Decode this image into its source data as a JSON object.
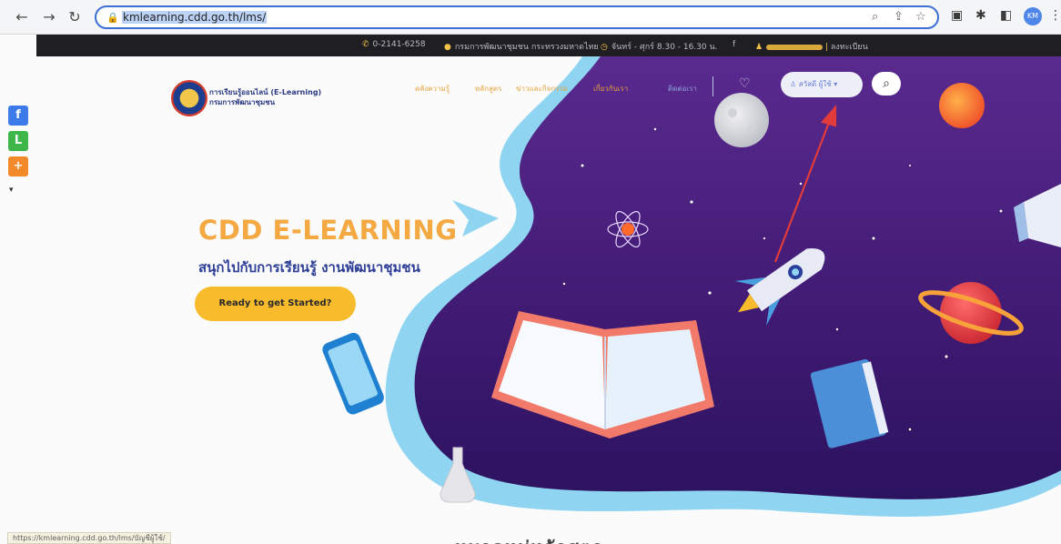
{
  "browser": {
    "url": "kmlearning.cdd.go.th/lms/",
    "profile_initials": "KM",
    "status_url": "https://kmlearning.cdd.go.th/lms/บัญชีผู้ใช้/"
  },
  "topbar": {
    "phone": "0-2141-6258",
    "address": "กรมการพัฒนาชุมชน กระทรวงมหาดไทย",
    "hours": "จันทร์ - ศุกร์ 8.30 - 16.30 น.",
    "register": "ลงทะเบียน"
  },
  "site": {
    "logo_line1": "การเรียนรู้ออนไลน์ (E-Learning)",
    "logo_line2": "กรมการพัฒนาชุมชน",
    "nav": [
      "คลังความรู้",
      "หลักสูตร",
      "ข่าวและกิจกรรม",
      "เกี่ยวกับเรา",
      "ติดต่อเรา"
    ],
    "login_label": "สวัสดี ผู้ใช้"
  },
  "hero": {
    "title": "CDD E-LEARNING",
    "subtitle": "สนุกไปกับการเรียนรู้ งานพัฒนาชุมชน",
    "cta_label": "Ready to get Started?"
  },
  "section": {
    "title": "หมวดหมู่หลักสูตร"
  },
  "colors": {
    "accent_orange": "#f4a942",
    "cta_yellow": "#f7bb2c",
    "brand_blue": "#2e3f98",
    "space_purple": "#4a1f7e",
    "annotation_red": "#e23b3b"
  },
  "icons": {
    "share": [
      "facebook-icon",
      "line-icon",
      "plus-icon"
    ],
    "topbar": [
      "phone-icon",
      "location-icon",
      "clock-icon",
      "user-icon"
    ]
  }
}
